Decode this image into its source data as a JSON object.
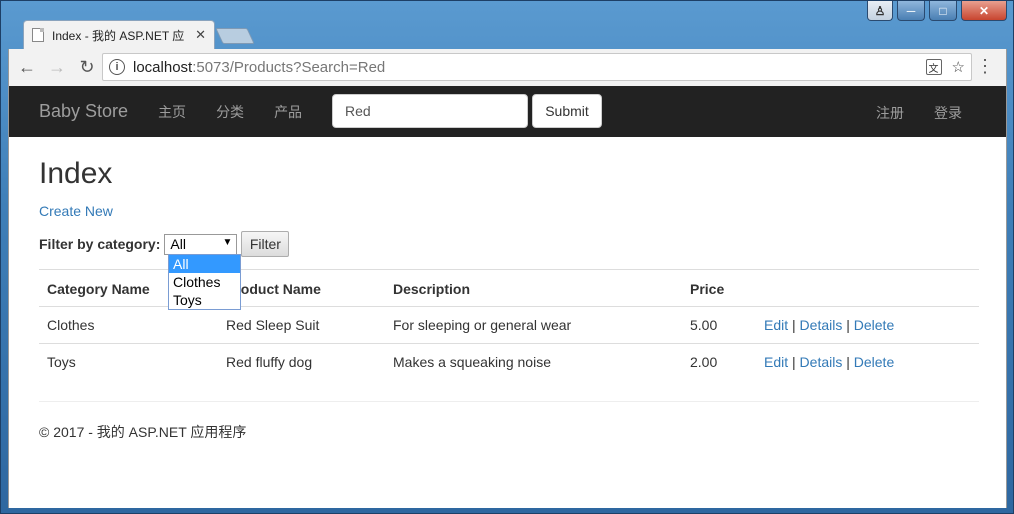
{
  "browser": {
    "tab_title": "Index - 我的 ASP.NET 应",
    "url_host": "localhost",
    "url_rest": ":5073/Products?Search=Red"
  },
  "navbar": {
    "brand": "Baby Store",
    "links": [
      "主页",
      "分类",
      "产品"
    ],
    "search_value": "Red",
    "submit_label": "Submit",
    "right_links": [
      "注册",
      "登录"
    ]
  },
  "page": {
    "title": "Index",
    "create_link": "Create New",
    "filter_label": "Filter by category:",
    "filter_selected": "All",
    "filter_button": "Filter",
    "filter_options": [
      "All",
      "Clothes",
      "Toys"
    ]
  },
  "table": {
    "headers": [
      "Category Name",
      "Product Name",
      "Description",
      "Price"
    ],
    "rows": [
      {
        "category": "Clothes",
        "name": "Red Sleep Suit",
        "description": "For sleeping or general wear",
        "price": "5.00"
      },
      {
        "category": "Toys",
        "name": "Red fluffy dog",
        "description": "Makes a squeaking noise",
        "price": "2.00"
      }
    ],
    "actions": {
      "edit": "Edit",
      "details": "Details",
      "delete": "Delete",
      "sep": "|"
    }
  },
  "footer": {
    "text": "© 2017 - 我的 ASP.NET 应用程序"
  },
  "colors": {
    "navbar_bg": "#222222",
    "link": "#337ab7",
    "selected_option": "#3399ff"
  }
}
